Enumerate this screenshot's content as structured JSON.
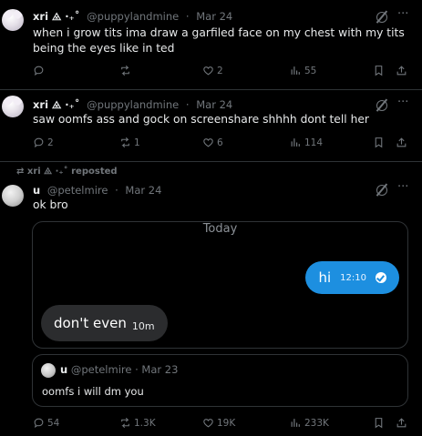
{
  "posts": [
    {
      "name": "xri ⨻ ·₊˚",
      "handle": "@puppylandmine",
      "date": "Mar 24",
      "text": "when i grow tits ima draw a garfiled face on my chest with my tits being the eyes like in ted",
      "replies": "",
      "reposts": "",
      "likes": "2",
      "views": "55"
    },
    {
      "name": "xri ⨻ ·₊˚",
      "handle": "@puppylandmine",
      "date": "Mar 24",
      "text": "saw oomfs ass and gock on screenshare shhhh dont tell her",
      "replies": "2",
      "reposts": "1",
      "likes": "6",
      "views": "114"
    },
    {
      "repost_label": "xri ⨻ ·₊˚ reposted",
      "name": "u",
      "handle": "@petelmire",
      "date": "Mar 24",
      "text": "ok bro",
      "replies": "54",
      "reposts": "1.3K",
      "likes": "19K",
      "views": "233K"
    }
  ],
  "dm_screenshot": {
    "day_label": "Today",
    "outgoing": {
      "message": "hi",
      "time": "12:10"
    },
    "incoming": {
      "message": "don't even",
      "time": "10m"
    }
  },
  "quote": {
    "name": "u",
    "handle": "@petelmire",
    "date": "Mar 23",
    "text": "oomfs i will dm you"
  },
  "colors": {
    "background": "#000000",
    "text": "#e7e9ea",
    "muted": "#71767b",
    "divider": "#2f3336",
    "bubble_out": "#1d8fe0",
    "bubble_in": "#2b2c2e"
  },
  "icons": [
    "grok-icon",
    "more-icon",
    "reply-icon",
    "repost-icon",
    "like-icon",
    "views-icon",
    "bookmark-icon",
    "share-icon"
  ]
}
